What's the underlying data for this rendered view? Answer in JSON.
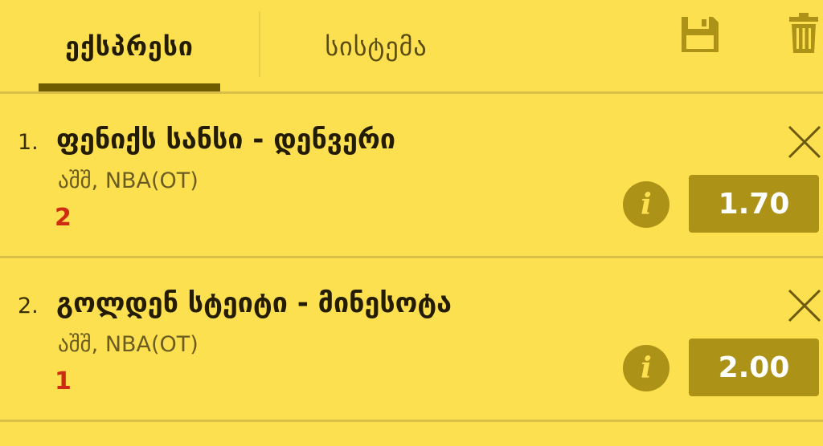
{
  "tabs": [
    {
      "label": "ექსპრესი",
      "active": true
    },
    {
      "label": "სისტემა",
      "active": false
    }
  ],
  "icons": {
    "save": "save-icon",
    "trash": "trash-icon",
    "close": "close-icon",
    "info": "info-icon"
  },
  "colors": {
    "background": "#fde050",
    "accent": "#ac9216",
    "pick": "#cf2a12"
  },
  "bets": [
    {
      "number": "1.",
      "title": "ფენიქს სანსი - დენვერი",
      "league": "აშშ, NBA(OT)",
      "pick": "2",
      "odds": "1.70"
    },
    {
      "number": "2.",
      "title": "გოლდენ სტეიტი - მინესოტა",
      "league": "აშშ, NBA(OT)",
      "pick": "1",
      "odds": "2.00"
    }
  ]
}
